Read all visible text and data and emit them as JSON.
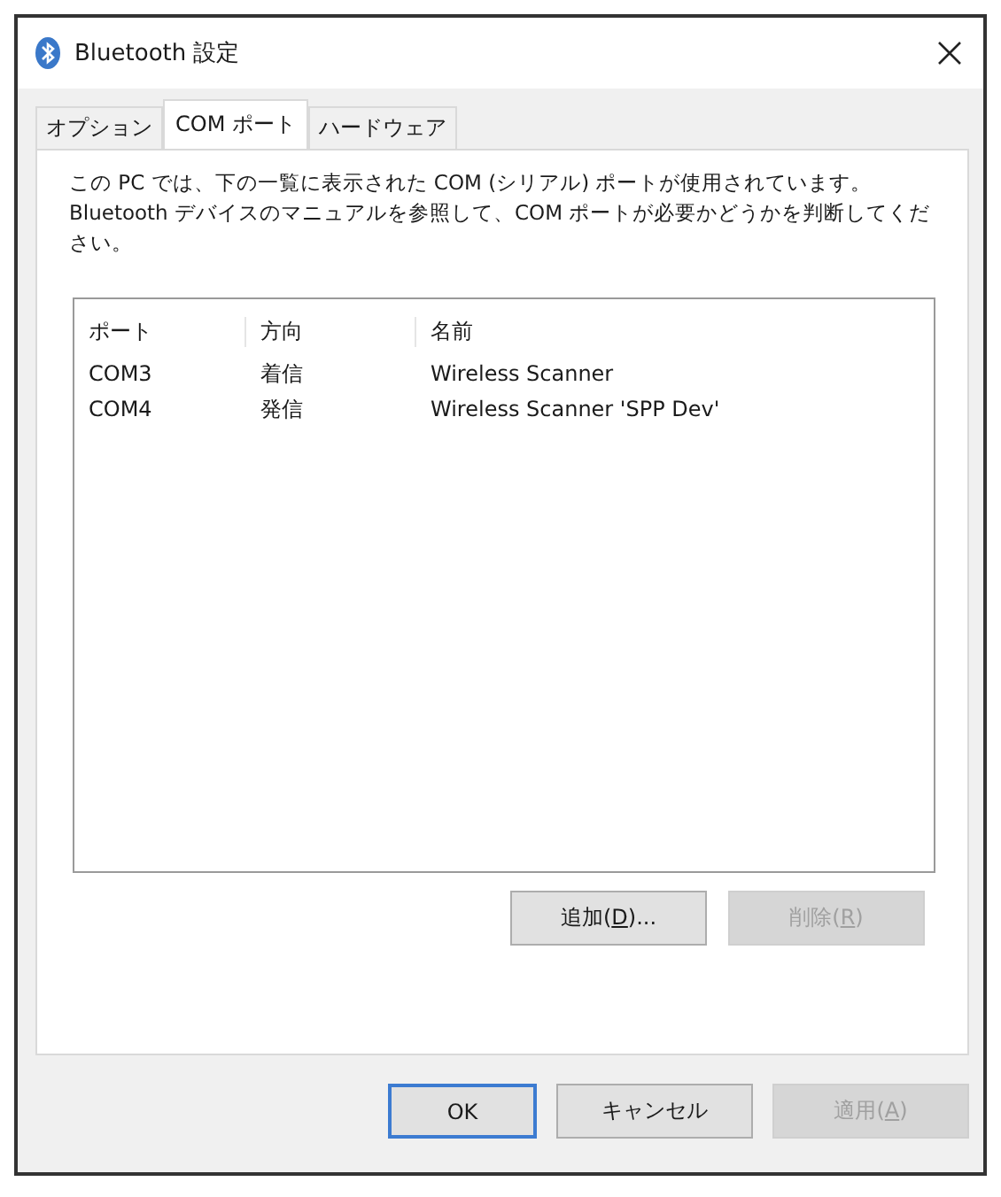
{
  "window": {
    "title": "Bluetooth 設定"
  },
  "tabs": [
    {
      "label": "オプション",
      "selected": false
    },
    {
      "label": "COM ポート",
      "selected": true
    },
    {
      "label": "ハードウェア",
      "selected": false
    }
  ],
  "description": "この PC では、下の一覧に表示された COM (シリアル) ポートが使用されています。Bluetooth デバイスのマニュアルを参照して、COM ポートが必要かどうかを判断してください。",
  "table": {
    "columns": [
      "ポート",
      "方向",
      "名前"
    ],
    "rows": [
      [
        "COM3",
        "着信",
        "Wireless Scanner"
      ],
      [
        "COM4",
        "発信",
        "Wireless Scanner 'SPP Dev'"
      ]
    ]
  },
  "list_buttons": [
    {
      "before": "追加(",
      "key": "D",
      "after": ")...",
      "disabled": false
    },
    {
      "before": "削除(",
      "key": "R",
      "after": ")",
      "disabled": true
    }
  ],
  "dialog_buttons": [
    {
      "before": "OK",
      "default": true,
      "disabled": false
    },
    {
      "before": "キャンセル",
      "default": false,
      "disabled": false
    },
    {
      "before": "適用(",
      "key": "A",
      "after": ")",
      "default": false,
      "disabled": true
    }
  ]
}
